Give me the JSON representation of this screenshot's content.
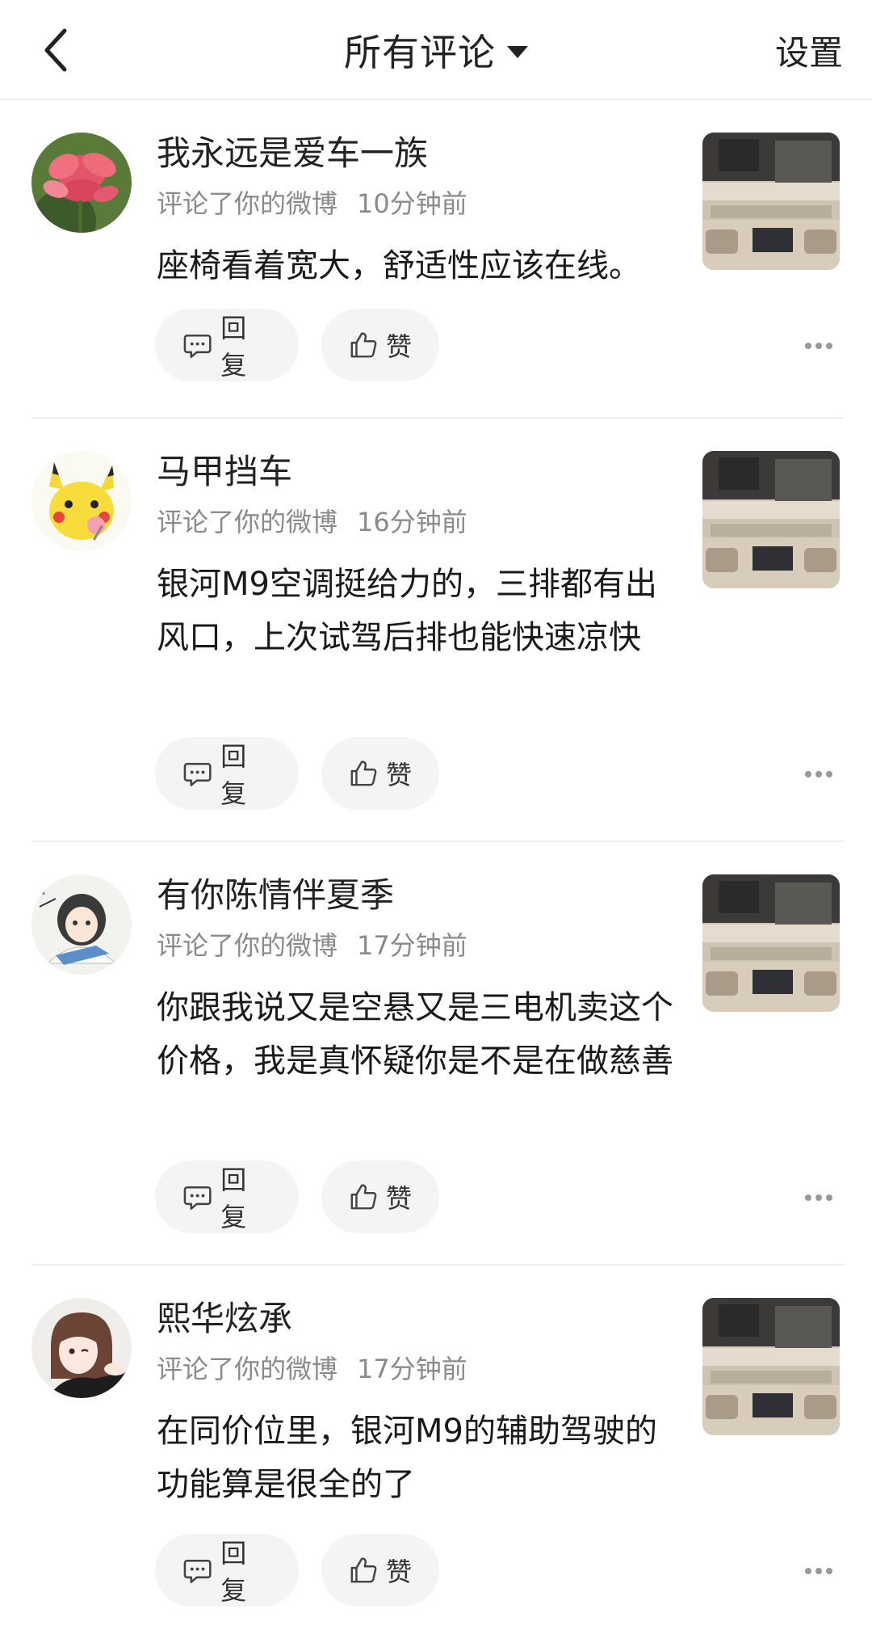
{
  "header": {
    "title": "所有评论",
    "settings_label": "设置"
  },
  "comments": [
    {
      "username": "我永远是爱车一族",
      "action": "评论了你的微博",
      "time": "10分钟前",
      "text": "座椅看着宽大，舒适性应该在线。",
      "reply_label": "回复",
      "like_label": "赞"
    },
    {
      "username": "马甲挡车",
      "action": "评论了你的微博",
      "time": "16分钟前",
      "text": "银河M9空调挺给力的，三排都有出风口，上次试驾后排也能快速凉快",
      "reply_label": "回复",
      "like_label": "赞"
    },
    {
      "username": "有你陈情伴夏季",
      "action": "评论了你的微博",
      "time": "17分钟前",
      "text": "你跟我说又是空悬又是三电机卖这个价格，我是真怀疑你是不是在做慈善",
      "reply_label": "回复",
      "like_label": "赞"
    },
    {
      "username": "熙华炫承",
      "action": "评论了你的微博",
      "time": "17分钟前",
      "text": "在同价位里，银河M9的辅助驾驶的功能算是很全的了",
      "reply_label": "回复",
      "like_label": "赞"
    }
  ],
  "colors": {
    "pill_bg": "#f4f4f4",
    "meta_text": "#8a8a8a",
    "divider": "#eeeeee"
  },
  "icons": {
    "back": "chevron-left-icon",
    "dropdown": "caret-down-icon",
    "reply": "comment-bubble-icon",
    "like": "thumbs-up-icon",
    "more": "more-dots-icon"
  }
}
